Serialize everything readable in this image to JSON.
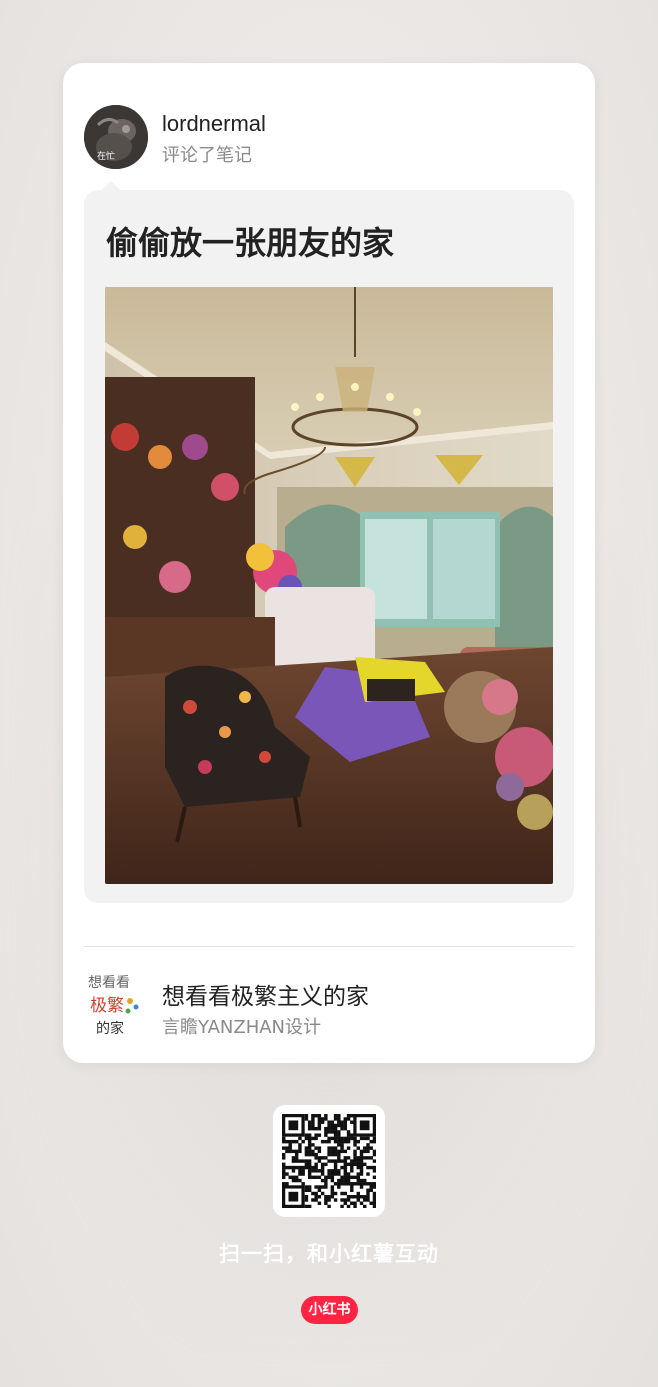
{
  "comment_card": {
    "user": {
      "name": "lordnermal",
      "action": "评论了笔记",
      "avatar_tag": "在忙"
    },
    "comment": {
      "text": "偷偷放一张朋友的家"
    },
    "note": {
      "title": "想看看极繁主义的家",
      "author": "言瞻YANZHAN设计",
      "thumb_lines": [
        "想看看",
        "极繁",
        "的家"
      ]
    }
  },
  "footer": {
    "scan_text": "扫一扫，和小红薯互动",
    "logo_text": "小红书"
  },
  "colors": {
    "brand": "#ff2442",
    "card_bg": "#ffffff",
    "bubble_bg": "#f2f2f2",
    "secondary_text": "#8a8a8a"
  }
}
